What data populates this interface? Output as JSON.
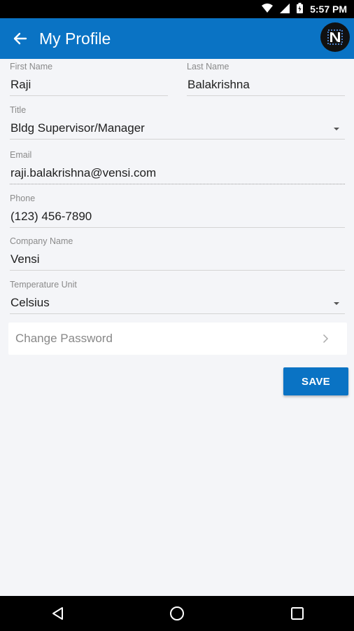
{
  "status_bar": {
    "time": "5:57 PM",
    "icons": [
      "wifi-icon",
      "signal-icon",
      "battery-icon"
    ]
  },
  "app_bar": {
    "title": "My Profile",
    "back_icon": "arrow-left-icon",
    "logo_icon": "app-logo-icon",
    "color": "#0a73c4"
  },
  "form": {
    "first_name": {
      "label": "First Name",
      "value": "Raji"
    },
    "last_name": {
      "label": "Last Name",
      "value": "Balakrishna"
    },
    "title": {
      "label": "Title",
      "value": "Bldg Supervisor/Manager"
    },
    "email": {
      "label": "Email",
      "value": "raji.balakrishna@vensi.com"
    },
    "phone": {
      "label": "Phone",
      "value": "(123) 456-7890"
    },
    "company": {
      "label": "Company Name",
      "value": "Vensi"
    },
    "temp_unit": {
      "label": "Temperature Unit",
      "value": "Celsius"
    }
  },
  "change_password": {
    "label": "Change Password",
    "icon": "chevron-right-icon"
  },
  "save_button": {
    "label": "SAVE"
  },
  "nav_bar": {
    "icons": [
      "back-triangle-icon",
      "home-circle-icon",
      "recents-square-icon"
    ]
  }
}
